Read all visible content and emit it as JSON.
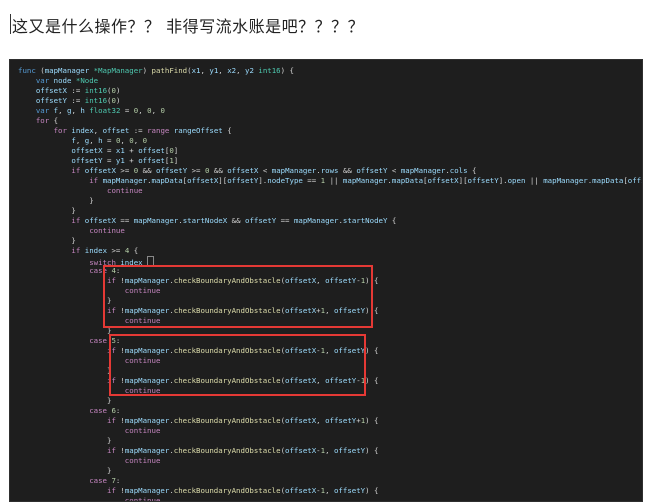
{
  "post": {
    "heading": "这又是什么操作？？ 非得写流水账是吧？？？？"
  },
  "code": {
    "lines": [
      [
        [
          "k",
          "func "
        ],
        [
          "p",
          "("
        ],
        [
          "v",
          "mapManager "
        ],
        [
          "t",
          "*MapManager"
        ],
        [
          "p",
          ") "
        ],
        [
          "f",
          "pathFind"
        ],
        [
          "p",
          "("
        ],
        [
          "v",
          "x1"
        ],
        [
          "p",
          ", "
        ],
        [
          "v",
          "y1"
        ],
        [
          "p",
          ", "
        ],
        [
          "v",
          "x2"
        ],
        [
          "p",
          ", "
        ],
        [
          "v",
          "y2 "
        ],
        [
          "t",
          "int16"
        ],
        [
          "p",
          ") {"
        ]
      ],
      [
        [
          "p",
          "    "
        ],
        [
          "k",
          "var "
        ],
        [
          "v",
          "node "
        ],
        [
          "t",
          "*Node"
        ]
      ],
      [
        [
          "p",
          "    "
        ],
        [
          "v",
          "offsetX "
        ],
        [
          "p",
          ":= "
        ],
        [
          "t",
          "int16"
        ],
        [
          "p",
          "("
        ],
        [
          "n",
          "0"
        ],
        [
          "p",
          ")"
        ]
      ],
      [
        [
          "p",
          "    "
        ],
        [
          "v",
          "offsetY "
        ],
        [
          "p",
          ":= "
        ],
        [
          "t",
          "int16"
        ],
        [
          "p",
          "("
        ],
        [
          "n",
          "0"
        ],
        [
          "p",
          ")"
        ]
      ],
      [
        [
          "p",
          "    "
        ],
        [
          "k",
          "var "
        ],
        [
          "v",
          "f"
        ],
        [
          "p",
          ", "
        ],
        [
          "v",
          "g"
        ],
        [
          "p",
          ", "
        ],
        [
          "v",
          "h "
        ],
        [
          "t",
          "float32 "
        ],
        [
          "p",
          "= "
        ],
        [
          "n",
          "0"
        ],
        [
          "p",
          ", "
        ],
        [
          "n",
          "0"
        ],
        [
          "p",
          ", "
        ],
        [
          "n",
          "0"
        ]
      ],
      [
        [
          "p",
          "    "
        ],
        [
          "c",
          "for "
        ],
        [
          "p",
          "{"
        ]
      ],
      [
        [
          "p",
          "        "
        ],
        [
          "c",
          "for "
        ],
        [
          "v",
          "index"
        ],
        [
          "p",
          ", "
        ],
        [
          "v",
          "offset "
        ],
        [
          "p",
          ":= "
        ],
        [
          "c",
          "range "
        ],
        [
          "v",
          "rangeOffset "
        ],
        [
          "p",
          "{"
        ]
      ],
      [
        [
          "p",
          "            "
        ],
        [
          "v",
          "f"
        ],
        [
          "p",
          ", "
        ],
        [
          "v",
          "g"
        ],
        [
          "p",
          ", "
        ],
        [
          "v",
          "h "
        ],
        [
          "p",
          "= "
        ],
        [
          "n",
          "0"
        ],
        [
          "p",
          ", "
        ],
        [
          "n",
          "0"
        ],
        [
          "p",
          ", "
        ],
        [
          "n",
          "0"
        ]
      ],
      [
        [
          "p",
          "            "
        ],
        [
          "v",
          "offsetX "
        ],
        [
          "p",
          "= "
        ],
        [
          "v",
          "x1 "
        ],
        [
          "p",
          "+ "
        ],
        [
          "v",
          "offset"
        ],
        [
          "p",
          "["
        ],
        [
          "n",
          "0"
        ],
        [
          "p",
          "]"
        ]
      ],
      [
        [
          "p",
          "            "
        ],
        [
          "v",
          "offsetY "
        ],
        [
          "p",
          "= "
        ],
        [
          "v",
          "y1 "
        ],
        [
          "p",
          "+ "
        ],
        [
          "v",
          "offset"
        ],
        [
          "p",
          "["
        ],
        [
          "n",
          "1"
        ],
        [
          "p",
          "]"
        ]
      ],
      [
        [
          "p",
          "            "
        ],
        [
          "c",
          "if "
        ],
        [
          "v",
          "offsetX "
        ],
        [
          "p",
          ">= "
        ],
        [
          "n",
          "0 "
        ],
        [
          "p",
          "&& "
        ],
        [
          "v",
          "offsetY "
        ],
        [
          "p",
          ">= "
        ],
        [
          "n",
          "0 "
        ],
        [
          "p",
          "&& "
        ],
        [
          "v",
          "offsetX "
        ],
        [
          "p",
          "< "
        ],
        [
          "v",
          "mapManager"
        ],
        [
          "p",
          "."
        ],
        [
          "v",
          "rows "
        ],
        [
          "p",
          "&& "
        ],
        [
          "v",
          "offsetY "
        ],
        [
          "p",
          "< "
        ],
        [
          "v",
          "mapManager"
        ],
        [
          "p",
          "."
        ],
        [
          "v",
          "cols "
        ],
        [
          "p",
          "{"
        ]
      ],
      [
        [
          "p",
          "                "
        ],
        [
          "c",
          "if "
        ],
        [
          "v",
          "mapManager"
        ],
        [
          "p",
          "."
        ],
        [
          "v",
          "mapData"
        ],
        [
          "p",
          "["
        ],
        [
          "v",
          "offsetX"
        ],
        [
          "p",
          "]["
        ],
        [
          "v",
          "offsetY"
        ],
        [
          "p",
          "]."
        ],
        [
          "v",
          "nodeType "
        ],
        [
          "p",
          "== "
        ],
        [
          "n",
          "1 "
        ],
        [
          "p",
          "|| "
        ],
        [
          "v",
          "mapManager"
        ],
        [
          "p",
          "."
        ],
        [
          "v",
          "mapData"
        ],
        [
          "p",
          "["
        ],
        [
          "v",
          "offsetX"
        ],
        [
          "p",
          "]["
        ],
        [
          "v",
          "offsetY"
        ],
        [
          "p",
          "]."
        ],
        [
          "v",
          "open "
        ],
        [
          "p",
          "|| "
        ],
        [
          "v",
          "mapManager"
        ],
        [
          "p",
          "."
        ],
        [
          "v",
          "mapData"
        ],
        [
          "p",
          "["
        ],
        [
          "v",
          "offsetX"
        ],
        [
          "p",
          "]["
        ],
        [
          "v",
          "offsetY"
        ],
        [
          "p",
          "]"
        ]
      ],
      [
        [
          "p",
          "                    "
        ],
        [
          "c",
          "continue"
        ]
      ],
      [
        [
          "p",
          "                }"
        ]
      ],
      [
        [
          "p",
          "            }"
        ]
      ],
      [
        [
          "p",
          "            "
        ],
        [
          "c",
          "if "
        ],
        [
          "v",
          "offsetX "
        ],
        [
          "p",
          "== "
        ],
        [
          "v",
          "mapManager"
        ],
        [
          "p",
          "."
        ],
        [
          "v",
          "startNodeX "
        ],
        [
          "p",
          "&& "
        ],
        [
          "v",
          "offsetY "
        ],
        [
          "p",
          "== "
        ],
        [
          "v",
          "mapManager"
        ],
        [
          "p",
          "."
        ],
        [
          "v",
          "startNodeY "
        ],
        [
          "p",
          "{"
        ]
      ],
      [
        [
          "p",
          "                "
        ],
        [
          "c",
          "continue"
        ]
      ],
      [
        [
          "p",
          "            }"
        ]
      ],
      [
        [
          "p",
          "            "
        ],
        [
          "c",
          "if "
        ],
        [
          "v",
          "index "
        ],
        [
          "p",
          ">= "
        ],
        [
          "n",
          "4 "
        ],
        [
          "p",
          "{"
        ]
      ],
      [
        [
          "p",
          "                "
        ],
        [
          "c",
          "switch "
        ],
        [
          "v",
          "index "
        ],
        [
          "cur",
          ""
        ]
      ],
      [
        [
          "p",
          "                "
        ],
        [
          "c",
          "case "
        ],
        [
          "n",
          "4"
        ],
        [
          "p",
          ":"
        ]
      ],
      [
        [
          "p",
          "                    "
        ],
        [
          "c",
          "if "
        ],
        [
          "p",
          "!"
        ],
        [
          "v",
          "mapManager"
        ],
        [
          "p",
          "."
        ],
        [
          "f",
          "checkBoundaryAndObstacle"
        ],
        [
          "p",
          "("
        ],
        [
          "v",
          "offsetX"
        ],
        [
          "p",
          ", "
        ],
        [
          "v",
          "offsetY"
        ],
        [
          "p",
          "-"
        ],
        [
          "n",
          "1"
        ],
        [
          "p",
          ") {"
        ]
      ],
      [
        [
          "p",
          "                        "
        ],
        [
          "c",
          "continue"
        ]
      ],
      [
        [
          "p",
          "                    }"
        ]
      ],
      [
        [
          "p",
          "                    "
        ],
        [
          "c",
          "if "
        ],
        [
          "p",
          "!"
        ],
        [
          "v",
          "mapManager"
        ],
        [
          "p",
          "."
        ],
        [
          "f",
          "checkBoundaryAndObstacle"
        ],
        [
          "p",
          "("
        ],
        [
          "v",
          "offsetX"
        ],
        [
          "p",
          "+"
        ],
        [
          "n",
          "1"
        ],
        [
          "p",
          ", "
        ],
        [
          "v",
          "offsetY"
        ],
        [
          "p",
          ") {"
        ]
      ],
      [
        [
          "p",
          "                        "
        ],
        [
          "c",
          "continue"
        ]
      ],
      [
        [
          "p",
          "                    }"
        ]
      ],
      [
        [
          "p",
          "                "
        ],
        [
          "c",
          "case "
        ],
        [
          "n",
          "5"
        ],
        [
          "p",
          ":"
        ]
      ],
      [
        [
          "p",
          "                    "
        ],
        [
          "c",
          "if "
        ],
        [
          "p",
          "!"
        ],
        [
          "v",
          "mapManager"
        ],
        [
          "p",
          "."
        ],
        [
          "f",
          "checkBoundaryAndObstacle"
        ],
        [
          "p",
          "("
        ],
        [
          "v",
          "offsetX"
        ],
        [
          "p",
          "-"
        ],
        [
          "n",
          "1"
        ],
        [
          "p",
          ", "
        ],
        [
          "v",
          "offsetY"
        ],
        [
          "p",
          ") {"
        ]
      ],
      [
        [
          "p",
          "                        "
        ],
        [
          "c",
          "continue"
        ]
      ],
      [
        [
          "p",
          "                    }"
        ]
      ],
      [
        [
          "p",
          "                    "
        ],
        [
          "c",
          "if "
        ],
        [
          "p",
          "!"
        ],
        [
          "v",
          "mapManager"
        ],
        [
          "p",
          "."
        ],
        [
          "f",
          "checkBoundaryAndObstacle"
        ],
        [
          "p",
          "("
        ],
        [
          "v",
          "offsetX"
        ],
        [
          "p",
          ", "
        ],
        [
          "v",
          "offsetY"
        ],
        [
          "p",
          "-"
        ],
        [
          "n",
          "1"
        ],
        [
          "p",
          ") {"
        ]
      ],
      [
        [
          "p",
          "                        "
        ],
        [
          "c",
          "continue"
        ]
      ],
      [
        [
          "p",
          "                    }"
        ]
      ],
      [
        [
          "p",
          "                "
        ],
        [
          "c",
          "case "
        ],
        [
          "n",
          "6"
        ],
        [
          "p",
          ":"
        ]
      ],
      [
        [
          "p",
          "                    "
        ],
        [
          "c",
          "if "
        ],
        [
          "p",
          "!"
        ],
        [
          "v",
          "mapManager"
        ],
        [
          "p",
          "."
        ],
        [
          "f",
          "checkBoundaryAndObstacle"
        ],
        [
          "p",
          "("
        ],
        [
          "v",
          "offsetX"
        ],
        [
          "p",
          ", "
        ],
        [
          "v",
          "offsetY"
        ],
        [
          "p",
          "+"
        ],
        [
          "n",
          "1"
        ],
        [
          "p",
          ") {"
        ]
      ],
      [
        [
          "p",
          "                        "
        ],
        [
          "c",
          "continue"
        ]
      ],
      [
        [
          "p",
          "                    }"
        ]
      ],
      [
        [
          "p",
          "                    "
        ],
        [
          "c",
          "if "
        ],
        [
          "p",
          "!"
        ],
        [
          "v",
          "mapManager"
        ],
        [
          "p",
          "."
        ],
        [
          "f",
          "checkBoundaryAndObstacle"
        ],
        [
          "p",
          "("
        ],
        [
          "v",
          "offsetX"
        ],
        [
          "p",
          "-"
        ],
        [
          "n",
          "1"
        ],
        [
          "p",
          ", "
        ],
        [
          "v",
          "offsetY"
        ],
        [
          "p",
          ") {"
        ]
      ],
      [
        [
          "p",
          "                        "
        ],
        [
          "c",
          "continue"
        ]
      ],
      [
        [
          "p",
          "                    }"
        ]
      ],
      [
        [
          "p",
          "                "
        ],
        [
          "c",
          "case "
        ],
        [
          "n",
          "7"
        ],
        [
          "p",
          ":"
        ]
      ],
      [
        [
          "p",
          "                    "
        ],
        [
          "c",
          "if "
        ],
        [
          "p",
          "!"
        ],
        [
          "v",
          "mapManager"
        ],
        [
          "p",
          "."
        ],
        [
          "f",
          "checkBoundaryAndObstacle"
        ],
        [
          "p",
          "("
        ],
        [
          "v",
          "offsetX"
        ],
        [
          "p",
          "-"
        ],
        [
          "n",
          "1"
        ],
        [
          "p",
          ", "
        ],
        [
          "v",
          "offsetY"
        ],
        [
          "p",
          ") {"
        ]
      ],
      [
        [
          "p",
          "                        "
        ],
        [
          "c",
          "continue"
        ]
      ]
    ]
  },
  "annotations": [
    {
      "color": "#e53935"
    },
    {
      "color": "#e53935"
    }
  ]
}
